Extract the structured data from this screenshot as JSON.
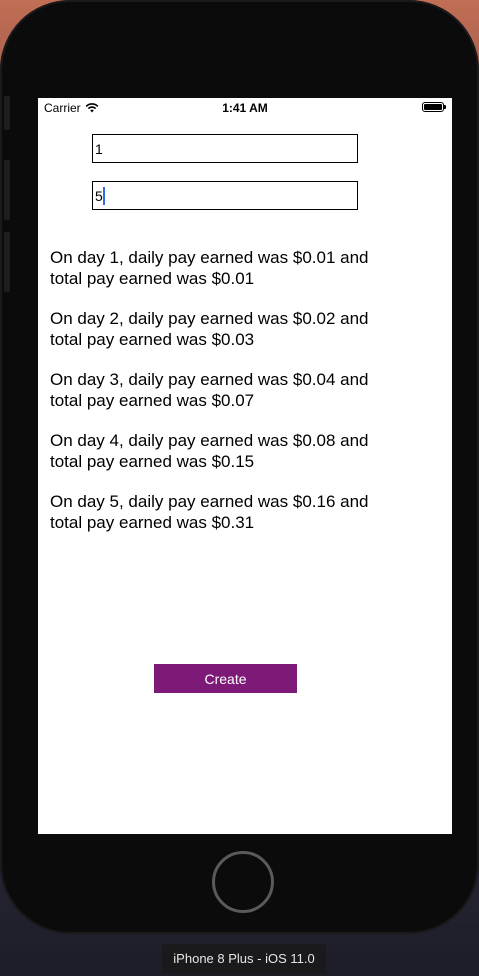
{
  "status_bar": {
    "carrier": "Carrier",
    "time": "1:41 AM"
  },
  "form": {
    "field1_value": "1",
    "field2_value": "5"
  },
  "results": [
    "On day 1, daily pay earned was $0.01 and total pay earned was $0.01",
    "On day 2, daily pay earned was $0.02 and total pay earned was $0.03",
    "On day 3, daily pay earned was $0.04 and total pay earned was $0.07",
    "On day 4, daily pay earned was $0.08 and total pay earned was $0.15",
    "On day 5, daily pay earned was $0.16 and total pay earned was $0.31"
  ],
  "create_label": "Create",
  "device_label": "iPhone 8 Plus - iOS 11.0",
  "colors": {
    "button": "#7d1a78",
    "caret": "#2f6ee0"
  },
  "icons": [
    "wifi-icon",
    "battery-icon"
  ]
}
